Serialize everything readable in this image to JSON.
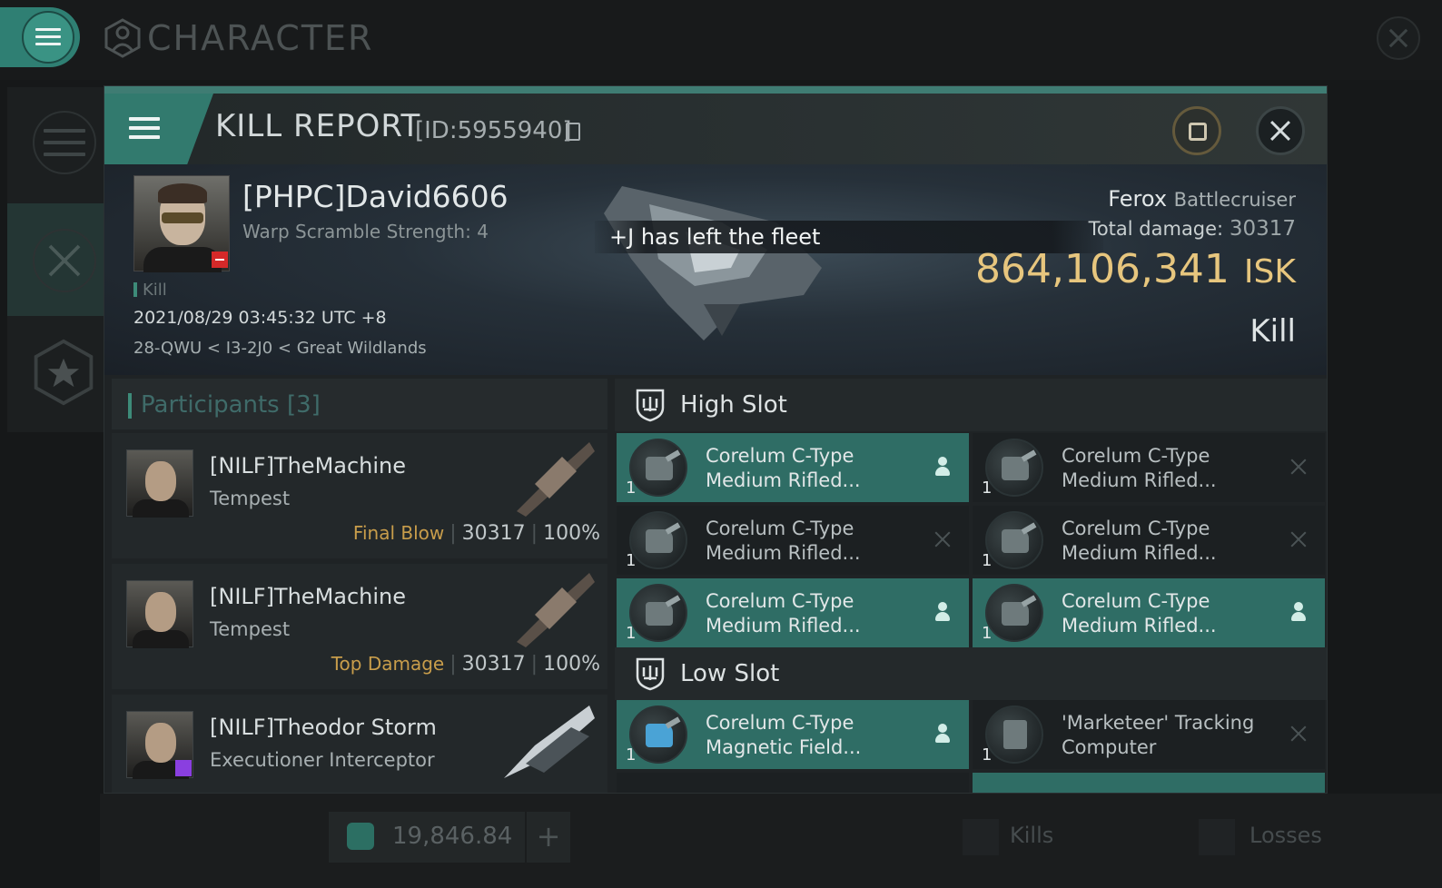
{
  "top_bar": {
    "title": "CHARACTER"
  },
  "bottom_bar": {
    "isk_balance": "19,846.84",
    "add_label": "+",
    "tab_kills": "Kills",
    "tab_losses": "Losses"
  },
  "kill_report": {
    "title": "KILL REPORT",
    "report_id": "[ID:5955940]",
    "victim": {
      "name": "[PHPC]David6606",
      "warp_scramble": "Warp Scramble Strength: 4",
      "kill_tag": "Kill",
      "datetime": "2021/08/29 03:45:32 UTC +8",
      "location": "28-QWU < I3-2J0 < Great Wildlands"
    },
    "ship": {
      "name": "Ferox",
      "class": "Battlecruiser"
    },
    "total_damage_label": "Total damage:",
    "total_damage": "30317",
    "isk_value": "864,106,341",
    "isk_unit": "ISK",
    "result": "Kill",
    "toast": "+J has left the fleet"
  },
  "participants": {
    "header": "Participants",
    "count": "[3]",
    "rows": [
      {
        "name": "[NILF]TheMachine",
        "ship": "Tempest",
        "tag": "Final Blow",
        "damage": "30317",
        "percent": "100%"
      },
      {
        "name": "[NILF]TheMachine",
        "ship": "Tempest",
        "tag": "Top Damage",
        "damage": "30317",
        "percent": "100%"
      },
      {
        "name": "[NILF]Theodor Storm",
        "ship": "Executioner Interceptor"
      }
    ]
  },
  "slots": {
    "high_slot_label": "High Slot",
    "low_slot_label": "Low Slot",
    "high": [
      {
        "qty": "1",
        "line1": "Corelum C-Type",
        "line2": "Medium Rifled...",
        "status": "dropped"
      },
      {
        "qty": "1",
        "line1": "Corelum C-Type",
        "line2": "Medium Rifled...",
        "status": "destroyed"
      },
      {
        "qty": "1",
        "line1": "Corelum C-Type",
        "line2": "Medium Rifled...",
        "status": "destroyed"
      },
      {
        "qty": "1",
        "line1": "Corelum C-Type",
        "line2": "Medium Rifled...",
        "status": "destroyed"
      },
      {
        "qty": "1",
        "line1": "Corelum C-Type",
        "line2": "Medium Rifled...",
        "status": "dropped"
      },
      {
        "qty": "1",
        "line1": "Corelum C-Type",
        "line2": "Medium Rifled...",
        "status": "dropped"
      }
    ],
    "low": [
      {
        "qty": "1",
        "line1": "Corelum C-Type",
        "line2": "Magnetic Field...",
        "status": "dropped"
      },
      {
        "qty": "1",
        "line1": "'Marketeer' Tracking",
        "line2": "Computer",
        "status": "destroyed"
      }
    ]
  },
  "colors": {
    "accent": "#2f7f73",
    "isk_gold": "#e7c67e",
    "final_blow": "#c89d4b"
  }
}
